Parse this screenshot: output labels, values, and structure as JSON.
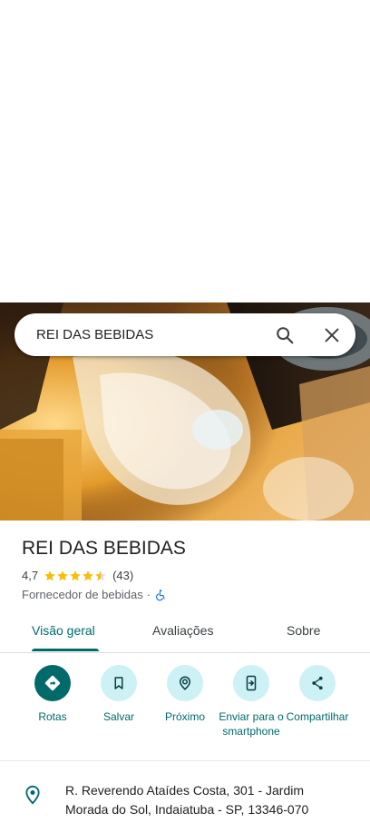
{
  "search": {
    "query": "REI DAS BEBIDAS"
  },
  "place": {
    "name": "REI DAS BEBIDAS",
    "rating": "4,7",
    "stars": 4.5,
    "review_count": "(43)",
    "category": "Fornecedor de bebidas",
    "separator": "·",
    "accessible": true
  },
  "tabs": [
    {
      "label": "Visão geral",
      "active": true
    },
    {
      "label": "Avaliações",
      "active": false
    },
    {
      "label": "Sobre",
      "active": false
    }
  ],
  "actions": [
    {
      "label": "Rotas",
      "icon": "directions-icon"
    },
    {
      "label": "Salvar",
      "icon": "bookmark-icon"
    },
    {
      "label": "Próximo",
      "icon": "nearby-icon"
    },
    {
      "label": "Enviar para o smartphone",
      "icon": "send-to-phone-icon"
    },
    {
      "label": "Compartilhar",
      "icon": "share-icon"
    }
  ],
  "address": "R. Reverendo Ataídes Costa, 301 - Jardim Morada do Sol, Indaiatuba - SP, 13346-070",
  "colors": {
    "accent": "#006a6b",
    "star": "#fbbc04",
    "action_bg": "#cdf1f5"
  }
}
